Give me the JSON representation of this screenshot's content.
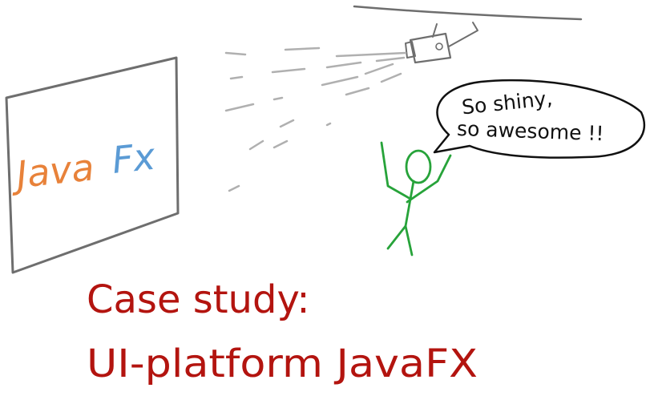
{
  "screen_logo": {
    "word_orange": "Java",
    "word_blue": "Fx",
    "color_orange": "#e8823a",
    "color_blue": "#5b9bd5"
  },
  "speech_bubble": {
    "line1": "So shiny,",
    "line2": "so awesome !!"
  },
  "caption": {
    "line1": "Case study:",
    "line2": "UI-platform JavaFX",
    "color": "#b3140f"
  },
  "colors": {
    "ink": "#6e6e6e",
    "beam": "#b0b0b0",
    "stick_figure": "#27a33a",
    "bubble_ink": "#111111"
  }
}
